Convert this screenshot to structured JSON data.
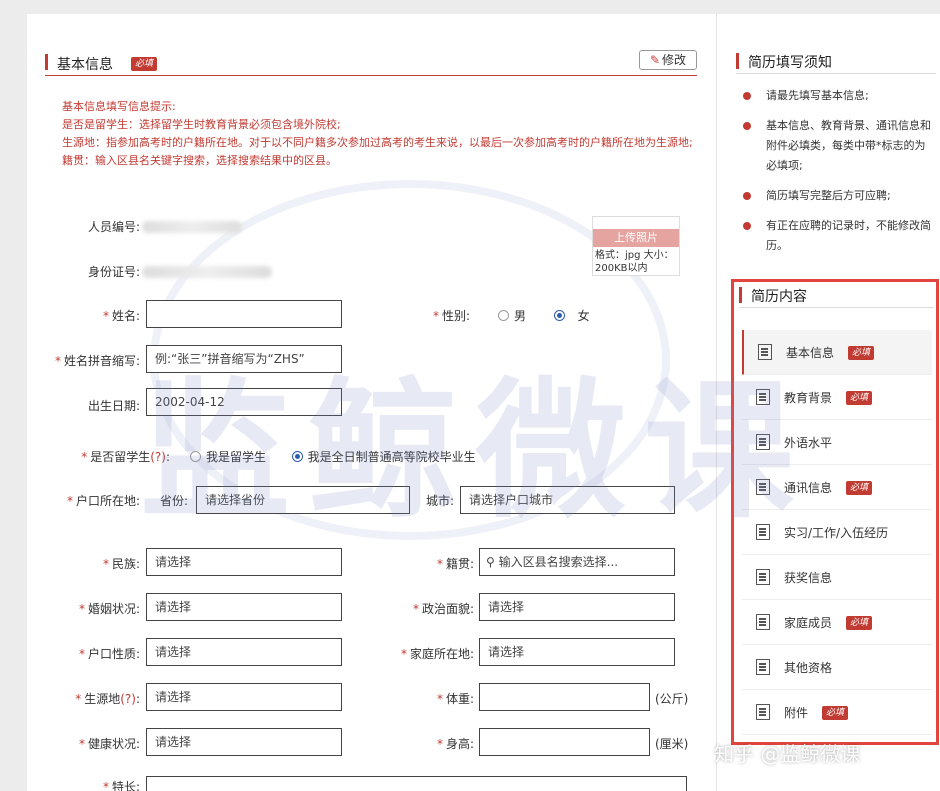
{
  "section": {
    "title": "基本信息",
    "required_badge": "必填",
    "edit_label": "修改"
  },
  "hints": [
    "基本信息填写信息提示:",
    "是否是留学生：选择留学生时教育背景必须包含境外院校;",
    "生源地：指参加高考时的户籍所在地。对于以不同户籍多次参加过高考的考生来说，以最后一次参加高考时的户籍所在地为生源地;",
    "籍贯：输入区县名关键字搜索，选择搜索结果中的区县。"
  ],
  "fields": {
    "person_no_label": "人员编号:",
    "id_label": "身份证号:",
    "name_label": "姓名:",
    "gender_label": "性别:",
    "gender_male": "男",
    "gender_female": "女",
    "gender_selected": "女",
    "pinyin_label": "姓名拼音缩写:",
    "pinyin_placeholder": "例:“张三”拼音缩写为“ZHS”",
    "birth_label": "出生日期:",
    "birth_value": "2002-04-12",
    "overseas_label": "是否留学生",
    "overseas_q": "(?)",
    "overseas_yes": "我是留学生",
    "overseas_no": "我是全日制普通高等院校毕业生",
    "overseas_selected": "我是全日制普通高等院校毕业生",
    "hukou_label": "户口所在地:",
    "province_label": "省份:",
    "province_value": "请选择省份",
    "city_label": "城市:",
    "city_value": "请选择户口城市",
    "nation_label": "民族:",
    "nation_value": "请选择",
    "native_label": "籍贯:",
    "native_placeholder": "输入区县名搜索选择...",
    "marital_label": "婚姻状况:",
    "marital_value": "请选择",
    "political_label": "政治面貌:",
    "political_value": "请选择",
    "hukou_type_label": "户口性质:",
    "hukou_type_value": "请选择",
    "home_label": "家庭所在地:",
    "home_value": "请选择",
    "origin_label": "生源地",
    "origin_q": "(?)",
    "origin_value": "请选择",
    "weight_label": "体重:",
    "weight_unit": "(公斤)",
    "health_label": "健康状况:",
    "health_value": "请选择",
    "height_label": "身高:",
    "height_unit": "(厘米)",
    "specialty_label": "特长:"
  },
  "photo": {
    "upload_label": "上传照片",
    "format_text": "格式：jpg 大小：200KB以内"
  },
  "notice": {
    "title": "简历填写须知",
    "items": [
      "请最先填写基本信息;",
      "基本信息、教育背景、通讯信息和附件必填类，每类中带*标志的为必填项;",
      "简历填写完整后方可应聘;",
      "有正在应聘的记录时，不能修改简历。"
    ]
  },
  "resume_nav": {
    "title": "简历内容",
    "badge": "必填",
    "items": [
      {
        "label": "基本信息",
        "required": true
      },
      {
        "label": "教育背景",
        "required": true
      },
      {
        "label": "外语水平",
        "required": false
      },
      {
        "label": "通讯信息",
        "required": true
      },
      {
        "label": "实习/工作/入伍经历",
        "required": false
      },
      {
        "label": "获奖信息",
        "required": false
      },
      {
        "label": "家庭成员",
        "required": true
      },
      {
        "label": "其他资格",
        "required": false
      },
      {
        "label": "附件",
        "required": true
      }
    ]
  },
  "watermark": {
    "text": "监鲸微课",
    "zhihu": "知乎 @监鲸微课"
  },
  "colors": {
    "accent": "#c23b33",
    "highlight_box": "#e2453f",
    "radio_selected": "#2a5db0"
  }
}
